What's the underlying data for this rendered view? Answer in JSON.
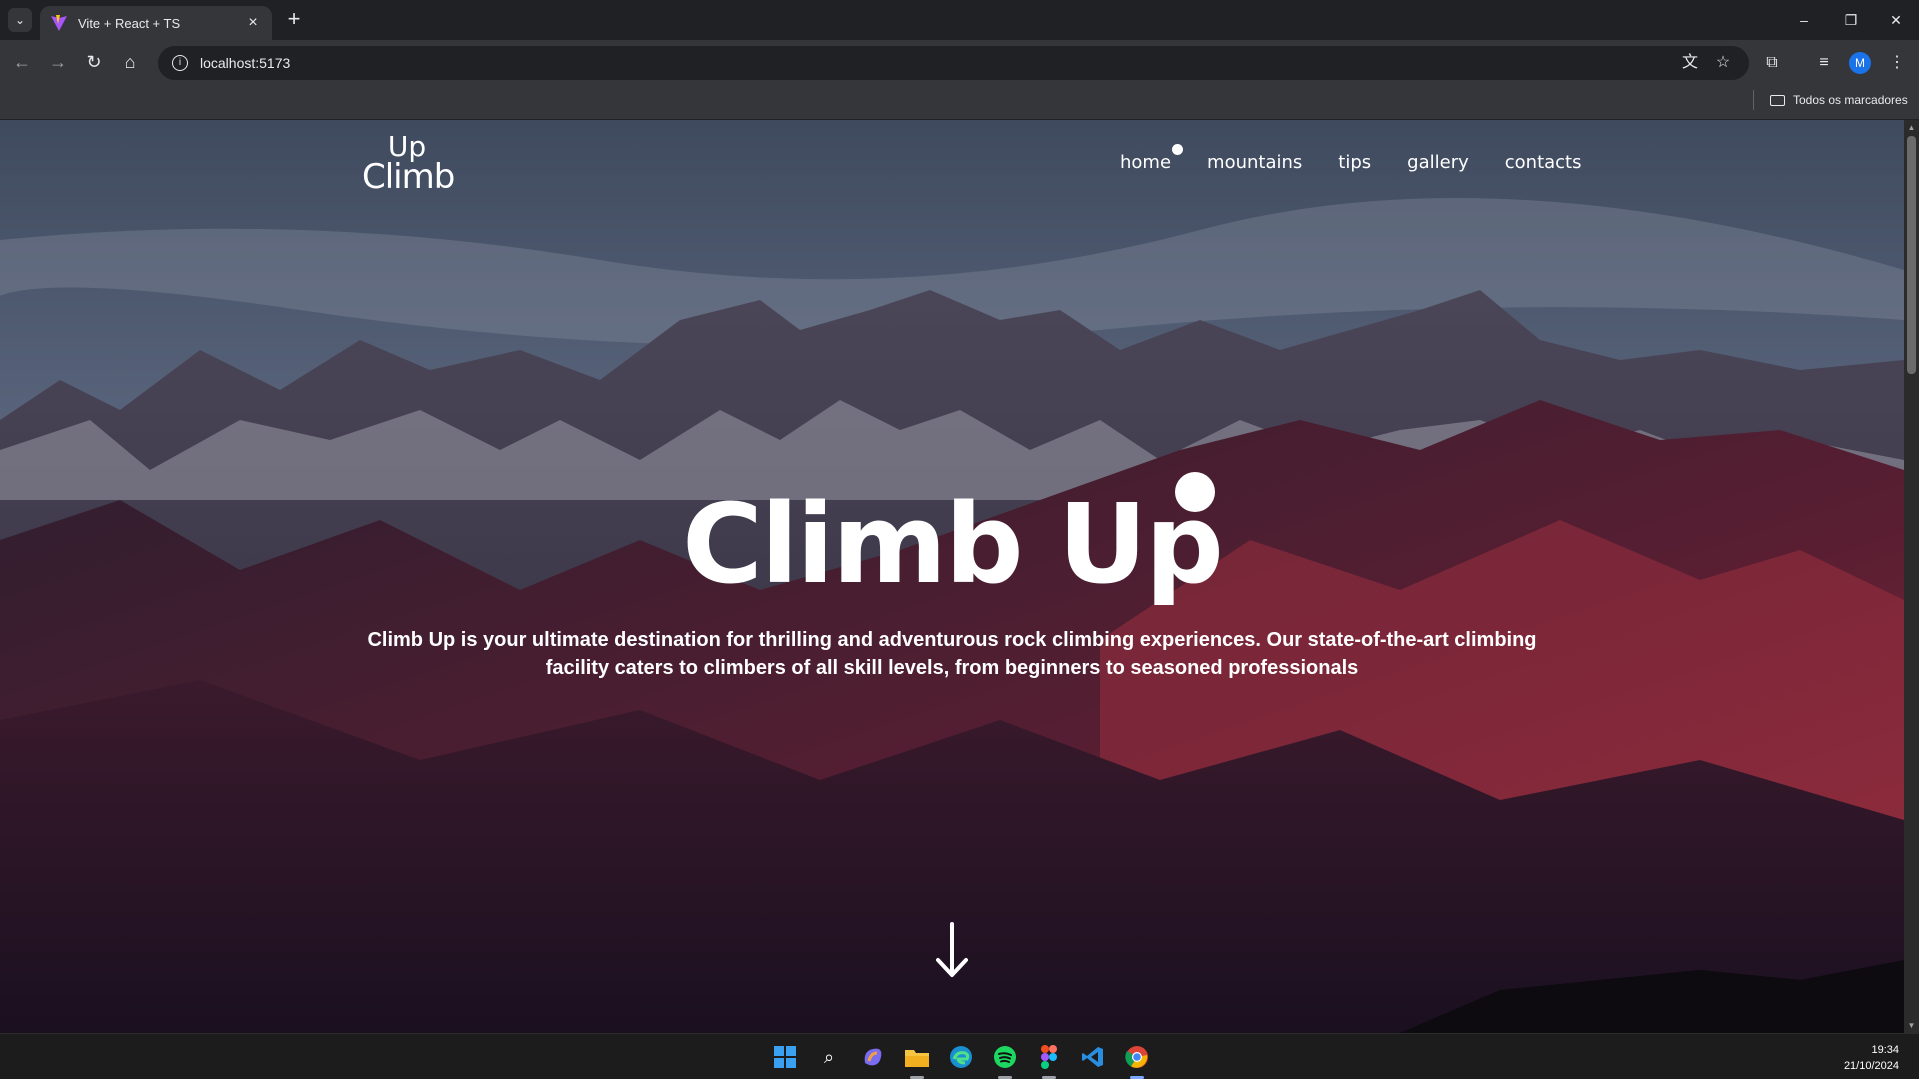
{
  "browser": {
    "tab_title": "Vite + React + TS",
    "url": "localhost:5173",
    "bookmarks_all": "Todos os marcadores",
    "profile_initial": "M"
  },
  "site": {
    "logo_line1": "Up",
    "logo_line2": "Climb",
    "nav": [
      "home",
      "mountains",
      "tips",
      "gallery",
      "contacts"
    ],
    "active_nav": "home",
    "hero_title": "Climb Up",
    "hero_text": "Climb Up is your ultimate destination for thrilling and adventurous rock climbing experiences. Our state-of-the-art climbing facility caters to climbers of all skill levels, from beginners to seasoned professionals"
  },
  "taskbar": {
    "apps": [
      "windows-start",
      "search",
      "copilot",
      "file-explorer",
      "edge",
      "spotify",
      "figma",
      "vscode",
      "chrome"
    ],
    "time": "19:34",
    "date": "21/10/2024"
  },
  "colors": {
    "chrome_dark": "#202124",
    "chrome_toolbar": "#35363a",
    "mountain_red": "#8a2a3c"
  }
}
